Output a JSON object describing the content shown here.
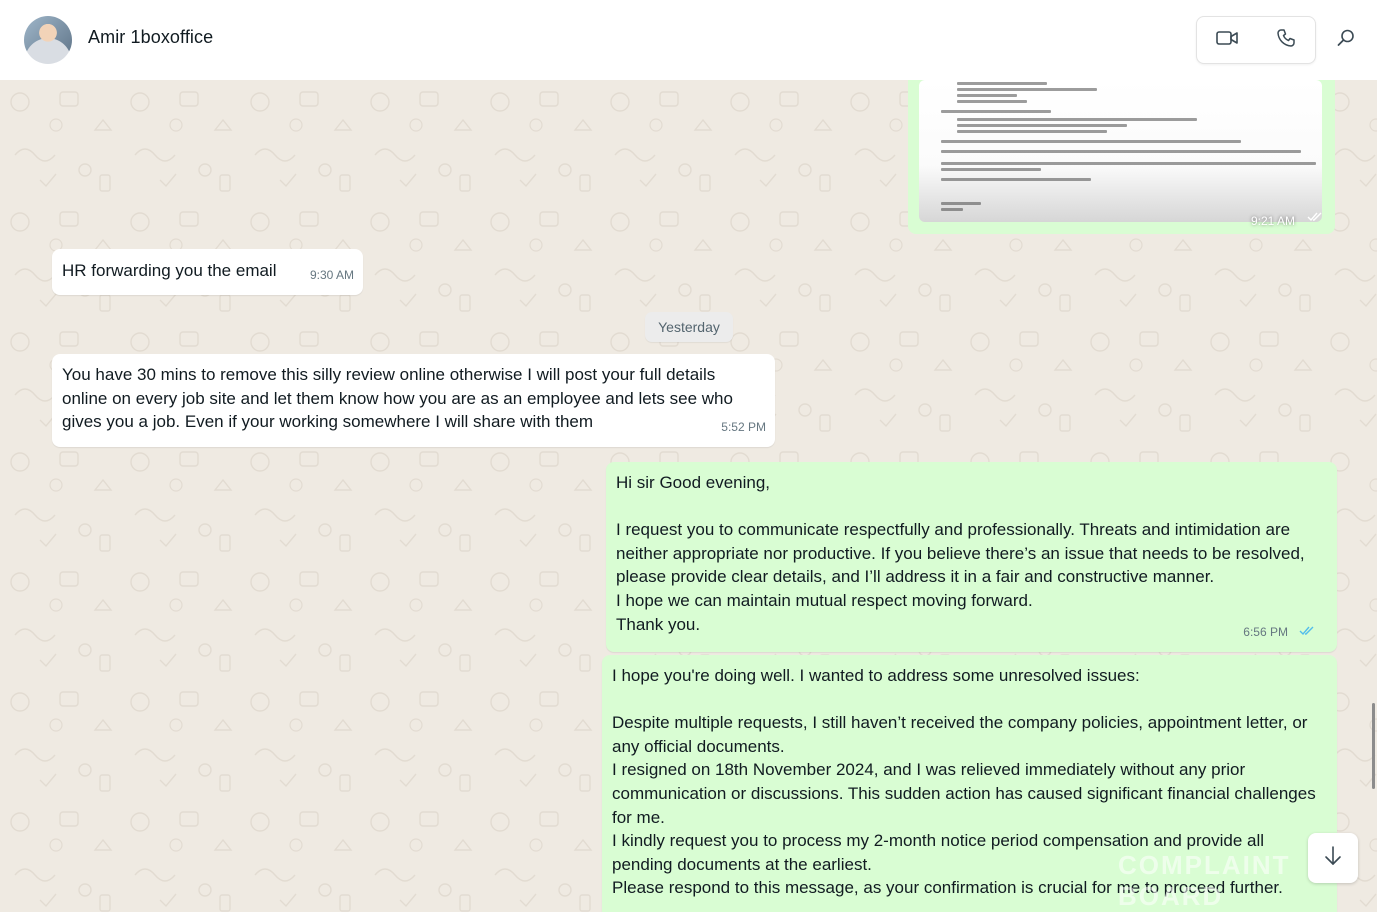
{
  "header": {
    "contact_name": "Amir 1boxoffice",
    "video_icon": "video-camera-icon",
    "voice_icon": "phone-icon",
    "search_icon": "search-icon"
  },
  "colors": {
    "incoming_bubble": "#ffffff",
    "outgoing_bubble": "#d9fdd3",
    "chat_background": "#efeae2",
    "read_tick": "#53bdeb"
  },
  "messages": [
    {
      "direction": "outgoing",
      "type": "image",
      "description_visible": "document screenshot",
      "time": "9:21 AM",
      "status": "read"
    },
    {
      "direction": "incoming",
      "text": "HR forwarding you the email",
      "time": "9:30 AM"
    },
    {
      "date_separator": "Yesterday"
    },
    {
      "direction": "incoming",
      "text": "You have 30 mins to remove this silly review online otherwise I will post your full details online on every job site and let them know how you are as an employee and lets see who gives you a job. Even if your working somewhere I will share with them",
      "time": "5:52 PM"
    },
    {
      "direction": "outgoing",
      "text": "Hi sir Good evening,\n\nI request you to communicate respectfully and professionally. Threats and intimidation are neither appropriate nor productive. If you believe there’s an issue that needs to be resolved, please provide clear details, and I’ll address it in a fair and constructive manner.\nI hope we can maintain mutual respect moving forward.\nThank you.",
      "time": "6:56 PM",
      "status": "read"
    },
    {
      "direction": "outgoing",
      "text": "I hope you're doing well. I wanted to address some unresolved issues:\n\nDespite multiple requests, I still haven’t received the company policies, appointment letter, or any official documents.\nI resigned on 18th November 2024, and I was relieved immediately without any prior communication or discussions. This sudden action has caused significant financial challenges for me.\nI kindly request you to process my 2-month notice period compensation and provide all pending documents at the earliest.\nPlease respond to this message, as your confirmation is crucial for me to proceed further.",
      "time": "",
      "status": ""
    }
  ],
  "scroll_down_icon": "arrow-down-icon",
  "watermark_text": "COMPLAINT BOARD"
}
